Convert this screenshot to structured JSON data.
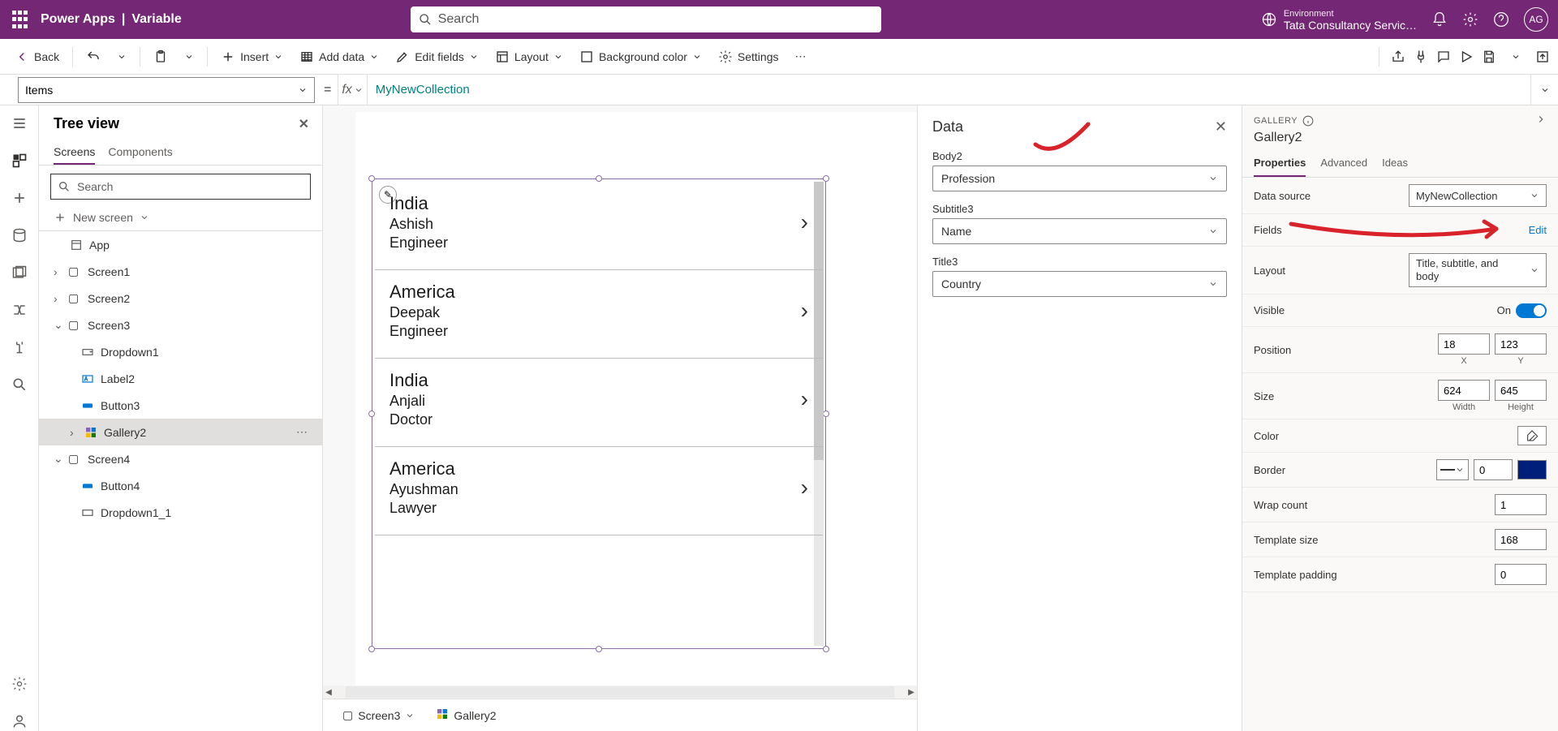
{
  "header": {
    "product": "Power Apps",
    "sep": "|",
    "doc": "Variable",
    "search_placeholder": "Search",
    "env_label": "Environment",
    "env_name": "Tata Consultancy Servic…",
    "avatar": "AG"
  },
  "cmdbar": {
    "back": "Back",
    "insert": "Insert",
    "add_data": "Add data",
    "edit_fields": "Edit fields",
    "layout": "Layout",
    "bg_color": "Background color",
    "settings": "Settings"
  },
  "formula": {
    "prop": "Items",
    "fx": "fx",
    "expr": "MyNewCollection"
  },
  "tree": {
    "title": "Tree view",
    "tab_screens": "Screens",
    "tab_components": "Components",
    "search_placeholder": "Search",
    "new_screen": "New screen",
    "app": "App",
    "items": {
      "screen1": "Screen1",
      "screen2": "Screen2",
      "screen3": "Screen3",
      "dropdown1": "Dropdown1",
      "label2": "Label2",
      "button3": "Button3",
      "gallery2": "Gallery2",
      "screen4": "Screen4",
      "button4": "Button4",
      "dropdown1_1": "Dropdown1_1"
    }
  },
  "gallery": [
    {
      "title": "India",
      "sub": "Ashish",
      "body": "Engineer"
    },
    {
      "title": "America",
      "sub": "Deepak",
      "body": "Engineer"
    },
    {
      "title": "India",
      "sub": "Anjali",
      "body": "Doctor"
    },
    {
      "title": "America",
      "sub": "Ayushman",
      "body": "Lawyer"
    }
  ],
  "footer": {
    "screen": "Screen3",
    "gallery": "Gallery2"
  },
  "datapane": {
    "title": "Data",
    "body2_lbl": "Body2",
    "body2_val": "Profession",
    "sub3_lbl": "Subtitle3",
    "sub3_val": "Name",
    "title3_lbl": "Title3",
    "title3_val": "Country"
  },
  "props": {
    "type": "GALLERY",
    "name": "Gallery2",
    "tab_props": "Properties",
    "tab_adv": "Advanced",
    "tab_ideas": "Ideas",
    "datasource_lbl": "Data source",
    "datasource_val": "MyNewCollection",
    "fields_lbl": "Fields",
    "fields_edit": "Edit",
    "layout_lbl": "Layout",
    "layout_val": "Title, subtitle, and body",
    "visible_lbl": "Visible",
    "visible_on": "On",
    "position_lbl": "Position",
    "pos_x": "18",
    "pos_y": "123",
    "x": "X",
    "y": "Y",
    "size_lbl": "Size",
    "width_v": "624",
    "height_v": "645",
    "width": "Width",
    "height": "Height",
    "color_lbl": "Color",
    "border_lbl": "Border",
    "border_v": "0",
    "wrap_lbl": "Wrap count",
    "wrap_v": "1",
    "tmplsize_lbl": "Template size",
    "tmplsize_v": "168",
    "tmplpad_lbl": "Template padding",
    "tmplpad_v": "0"
  }
}
